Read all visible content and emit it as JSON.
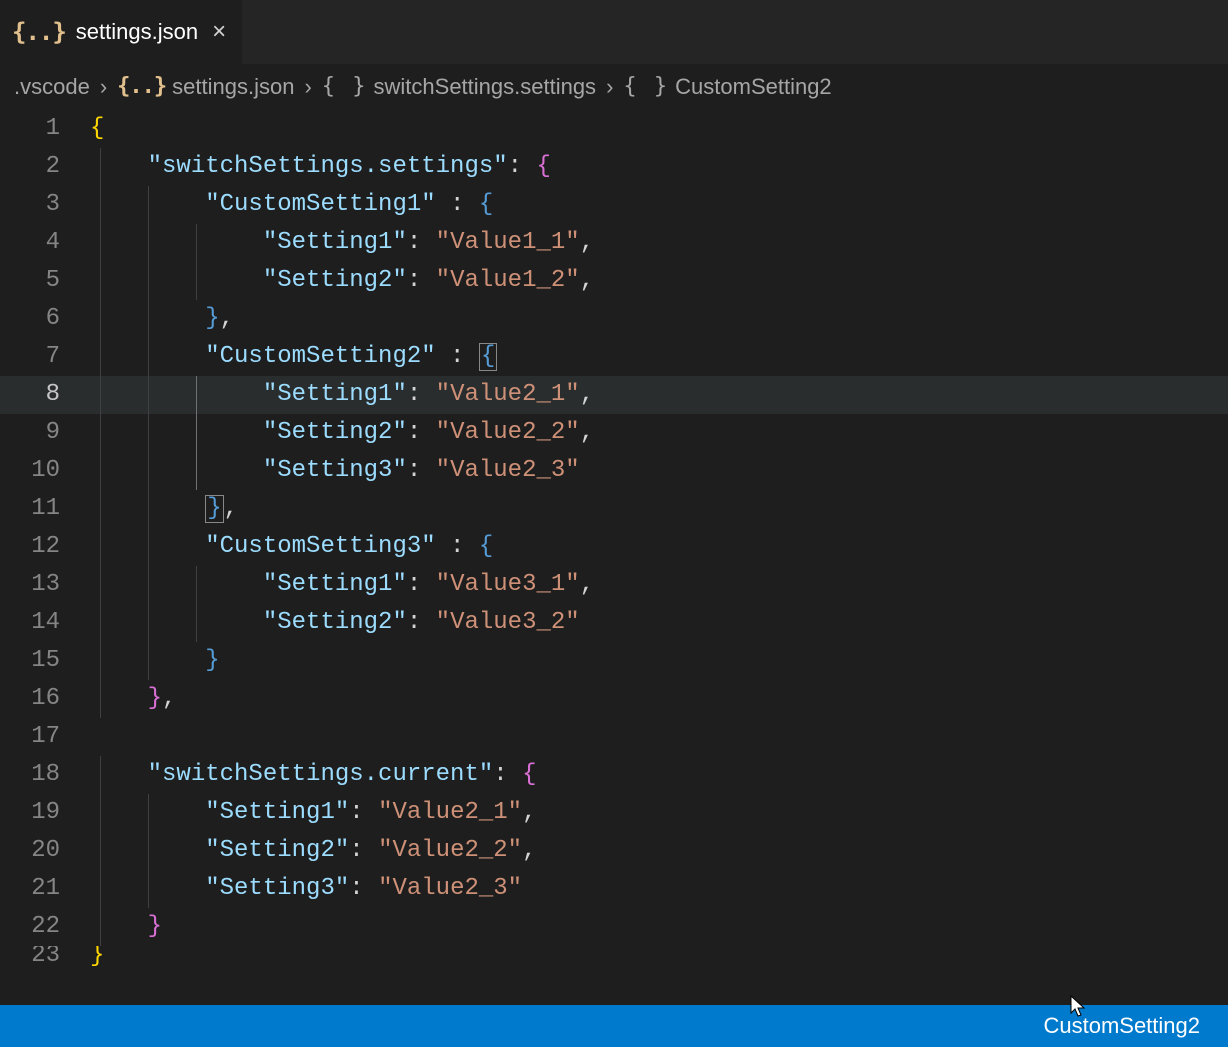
{
  "tab": {
    "icon_text": "{..}",
    "title": "settings.json",
    "close_glyph": "×"
  },
  "breadcrumb": {
    "crumb1": ".vscode",
    "chev": "›",
    "icon_json": "{..}",
    "crumb2": "settings.json",
    "icon_obj": "{ }",
    "crumb3": "switchSettings.settings",
    "crumb4": "CustomSetting2"
  },
  "lines": {
    "ln1": "1",
    "ln2": "2",
    "ln3": "3",
    "ln4": "4",
    "ln5": "5",
    "ln6": "6",
    "ln7": "7",
    "ln8": "8",
    "ln9": "9",
    "ln10": "10",
    "ln11": "11",
    "ln12": "12",
    "ln13": "13",
    "ln14": "14",
    "ln15": "15",
    "ln16": "16",
    "ln17": "17",
    "ln18": "18",
    "ln19": "19",
    "ln20": "20",
    "ln21": "21",
    "ln22": "22",
    "ln23": "23"
  },
  "code": {
    "l1_brace": "{",
    "l2_key": "\"switchSettings.settings\"",
    "l2_colon": ": ",
    "l2_brace": "{",
    "l3_key": "\"CustomSetting1\"",
    "l3_colon": " : ",
    "l3_brace": "{",
    "l4_key": "\"Setting1\"",
    "l4_colon": ": ",
    "l4_val": "\"Value1_1\"",
    "l4_comma": ",",
    "l5_key": "\"Setting2\"",
    "l5_colon": ": ",
    "l5_val": "\"Value1_2\"",
    "l5_comma": ",",
    "l6_brace": "}",
    "l6_comma": ",",
    "l7_key": "\"CustomSetting2\"",
    "l7_colon": " : ",
    "l7_brace": "{",
    "l8_key": "\"Setting1\"",
    "l8_colon": ": ",
    "l8_val": "\"Value2_1\"",
    "l8_comma": ",",
    "l9_key": "\"Setting2\"",
    "l9_colon": ": ",
    "l9_val": "\"Value2_2\"",
    "l9_comma": ",",
    "l10_key": "\"Setting3\"",
    "l10_colon": ": ",
    "l10_val": "\"Value2_3\"",
    "l11_brace": "}",
    "l11_comma": ",",
    "l12_key": "\"CustomSetting3\"",
    "l12_colon": " : ",
    "l12_brace": "{",
    "l13_key": "\"Setting1\"",
    "l13_colon": ": ",
    "l13_val": "\"Value3_1\"",
    "l13_comma": ",",
    "l14_key": "\"Setting2\"",
    "l14_colon": ": ",
    "l14_val": "\"Value3_2\"",
    "l15_brace": "}",
    "l16_brace": "}",
    "l16_comma": ",",
    "l17_blank": "",
    "l18_key": "\"switchSettings.current\"",
    "l18_colon": ": ",
    "l18_brace": "{",
    "l19_key": "\"Setting1\"",
    "l19_colon": ": ",
    "l19_val": "\"Value2_1\"",
    "l19_comma": ",",
    "l20_key": "\"Setting2\"",
    "l20_colon": ": ",
    "l20_val": "\"Value2_2\"",
    "l20_comma": ",",
    "l21_key": "\"Setting3\"",
    "l21_colon": ": ",
    "l21_val": "\"Value2_3\"",
    "l22_brace": "}",
    "l23_brace": "}"
  },
  "status": {
    "current_setting": "CustomSetting2"
  }
}
